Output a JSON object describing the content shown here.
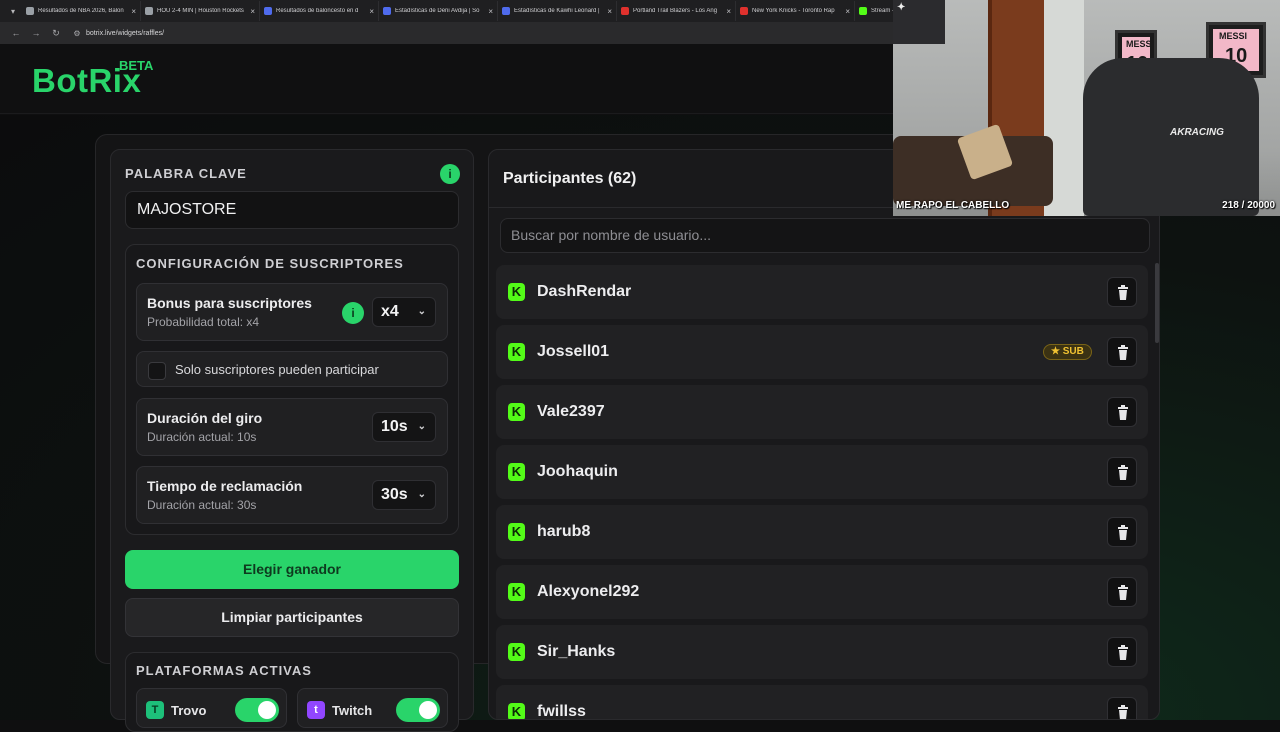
{
  "browser": {
    "tabs": [
      {
        "title": "Resultados de NBA 2026, Balon",
        "color": "#9aa0a6"
      },
      {
        "title": "HOU 2-4 MIN | Houston Rockets",
        "color": "#9aa0a6"
      },
      {
        "title": "Resultados de baloncesto en d",
        "color": "#4f6bed"
      },
      {
        "title": "Estadísticas de Deni Avdija | So",
        "color": "#4f6bed"
      },
      {
        "title": "Estadísticas de Kawhi Leonard |",
        "color": "#4f6bed"
      },
      {
        "title": "Portland Trail Blazers - Los Ang",
        "color": "#e0312d"
      },
      {
        "title": "New York Knicks - Toronto Rap",
        "color": "#e0312d"
      },
      {
        "title": "Stream -",
        "color": "#53fc18"
      }
    ],
    "url": "botrix.live/widgets/raffles/"
  },
  "brand": {
    "name": "BotRix",
    "badge": "BETA",
    "accent": "#29d46a"
  },
  "left": {
    "keyword_label": "PALABRA CLAVE",
    "keyword_value": "MAJOSTORE",
    "subs_title": "CONFIGURACIÓN DE SUSCRIPTORES",
    "bonus": {
      "title": "Bonus para suscriptores",
      "subtitle": "Probabilidad total: x4",
      "value": "x4"
    },
    "only_subs_label": "Solo suscriptores pueden participar",
    "spin": {
      "title": "Duración del giro",
      "subtitle": "Duración actual: 10s",
      "value": "10s"
    },
    "claim": {
      "title": "Tiempo de reclamación",
      "subtitle": "Duración actual: 30s",
      "value": "30s"
    },
    "pick_winner": "Elegir ganador",
    "clear": "Limpiar participantes",
    "platforms_title": "PLATAFORMAS ACTIVAS",
    "platforms": [
      {
        "name": "Trovo",
        "enabled": true
      },
      {
        "name": "Twitch",
        "enabled": true
      }
    ]
  },
  "participants": {
    "title": "Participantes (62)",
    "search_placeholder": "Buscar por nombre de usuario...",
    "sub_badge": "SUB",
    "items": [
      {
        "name": "DashRendar",
        "sub": false
      },
      {
        "name": "Jossell01",
        "sub": true
      },
      {
        "name": "Vale2397",
        "sub": false
      },
      {
        "name": "Joohaquin",
        "sub": false
      },
      {
        "name": "harub8",
        "sub": false
      },
      {
        "name": "Alexyonel292",
        "sub": false
      },
      {
        "name": "Sir_Hanks",
        "sub": false
      },
      {
        "name": "fwillss",
        "sub": false
      }
    ]
  },
  "webcam": {
    "caption": "ME RAPO EL CABELLO",
    "counter": "218 / 20000",
    "frame_text": "MESSI",
    "frame_number": "10",
    "chair_brand": "AKRACING"
  }
}
